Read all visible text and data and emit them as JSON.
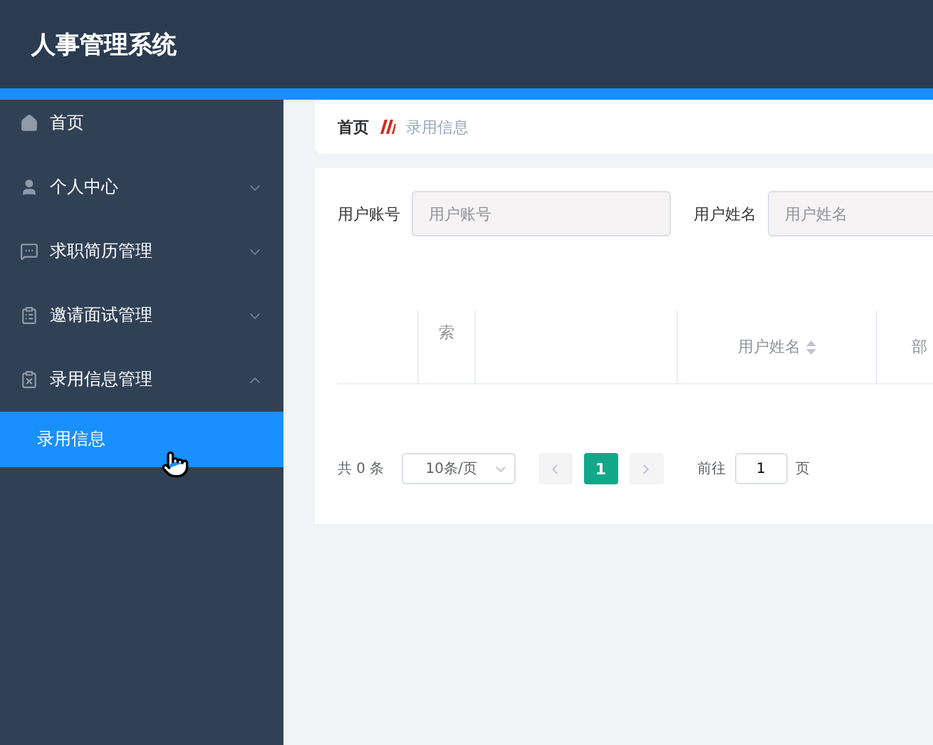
{
  "header": {
    "title": "人事管理系统"
  },
  "sidebar": {
    "items": [
      {
        "label": "首页",
        "expandable": false
      },
      {
        "label": "个人中心",
        "expandable": true,
        "expanded": false
      },
      {
        "label": "求职简历管理",
        "expandable": true,
        "expanded": false
      },
      {
        "label": "邀请面试管理",
        "expandable": true,
        "expanded": false
      },
      {
        "label": "录用信息管理",
        "expandable": true,
        "expanded": true,
        "children": [
          {
            "label": "录用信息",
            "selected": true
          }
        ]
      }
    ]
  },
  "breadcrumb": [
    {
      "label": "首页",
      "current": false
    },
    {
      "label": "录用信息",
      "current": true
    }
  ],
  "search": [
    {
      "label": "用户账号",
      "placeholder": "用户账号"
    },
    {
      "label": "用户姓名",
      "placeholder": "用户姓名"
    }
  ],
  "table": {
    "columns": [
      {
        "sortable": false
      },
      {
        "label": "索",
        "sortable": false
      },
      {
        "sortable": false
      },
      {
        "label": "用户姓名",
        "sortable": true
      },
      {
        "label": "部",
        "sortable": false
      }
    ]
  },
  "pagination": {
    "total": "共 0 条",
    "page_size": "10条/页",
    "pages": [
      {
        "label": "1",
        "selected": true
      }
    ],
    "goto_label": "前往",
    "goto_value": "1",
    "goto_suffix": "页"
  }
}
